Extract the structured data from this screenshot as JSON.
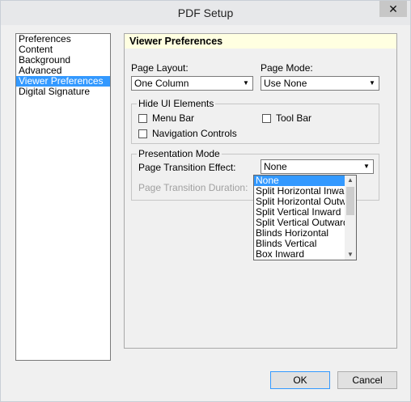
{
  "window": {
    "title": "PDF Setup",
    "close_glyph": "✕"
  },
  "nav": {
    "items": [
      {
        "label": "Preferences",
        "selected": false
      },
      {
        "label": "Content",
        "selected": false
      },
      {
        "label": "Background",
        "selected": false
      },
      {
        "label": "Advanced",
        "selected": false
      },
      {
        "label": "Viewer Preferences",
        "selected": true
      },
      {
        "label": "Digital Signature",
        "selected": false
      }
    ]
  },
  "panel": {
    "header": "Viewer Preferences",
    "page_layout": {
      "label": "Page Layout:",
      "value": "One Column"
    },
    "page_mode": {
      "label": "Page Mode:",
      "value": "Use None"
    },
    "hide_ui": {
      "title": "Hide UI Elements",
      "menu_bar": "Menu Bar",
      "tool_bar": "Tool Bar",
      "navigation_controls": "Navigation Controls"
    },
    "presentation": {
      "title": "Presentation Mode",
      "transition_label": "Page Transition Effect:",
      "transition_value": "None",
      "duration_label": "Page Transition Duration:"
    }
  },
  "dropdown": {
    "options": [
      "None",
      "Split Horizontal Inward",
      "Split Horizontal Outward",
      "Split Vertical Inward",
      "Split Vertical Outward",
      "Blinds Horizontal",
      "Blinds Vertical",
      "Box Inward"
    ],
    "selected_index": 0
  },
  "buttons": {
    "ok": "OK",
    "cancel": "Cancel"
  }
}
